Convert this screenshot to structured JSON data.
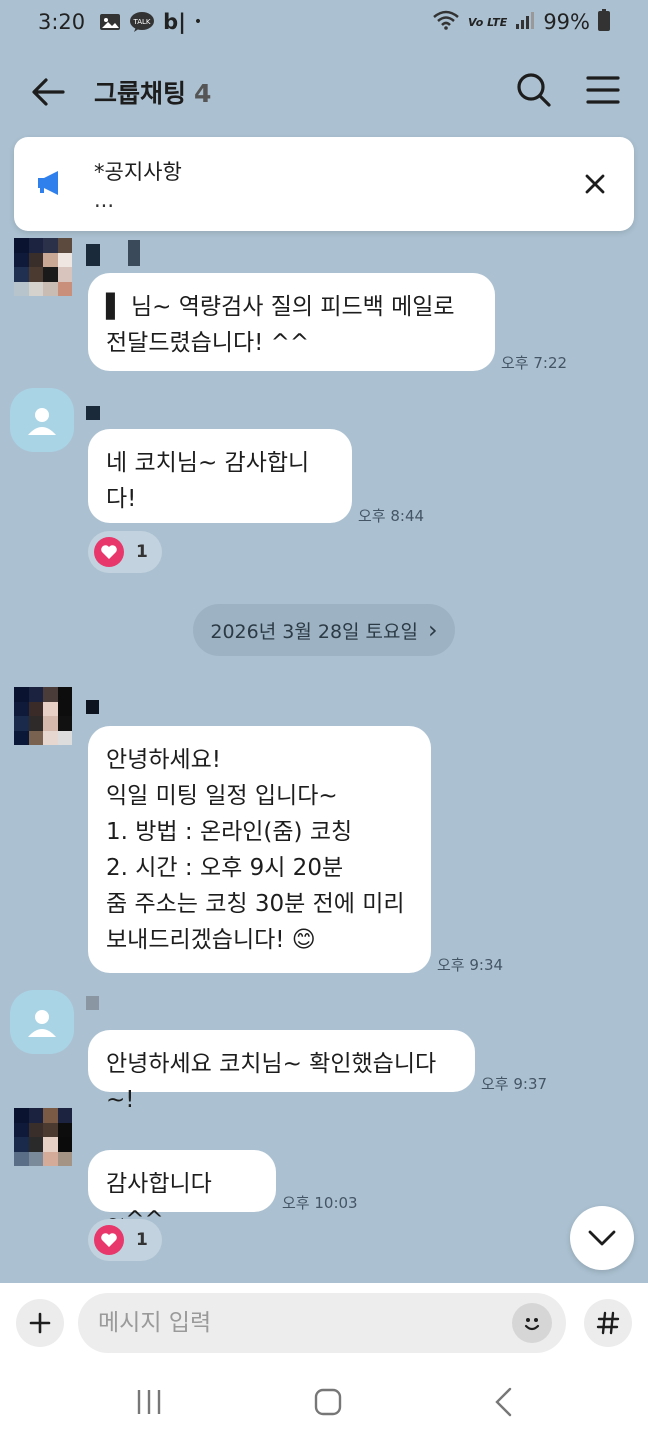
{
  "status": {
    "time": "3:20",
    "kakao_badge": "TALK",
    "app_text": "b|",
    "dot": "•",
    "network": "Vo LTE",
    "battery": "99%"
  },
  "header": {
    "title": "그룹채팅",
    "count": "4"
  },
  "notice": {
    "title": "*공지사항",
    "subtitle": "..."
  },
  "messages": [
    {
      "text": "▌ 님~ 역량검사 질의 피드백 메일로\n전달드렸습니다! ^^",
      "time": "오후 7:22"
    },
    {
      "text": "네 코치님~ 감사합니다!",
      "time": "오후 8:44",
      "reaction_count": "1"
    },
    {
      "text": "안녕하세요!\n익일 미팅 일정 입니다~\n1. 방법 : 온라인(줌) 코칭\n2. 시간 : 오후 9시 20분\n줌 주소는 코칭 30분 전에 미리\n보내드리겠습니다! 😊",
      "time": "오후 9:34"
    },
    {
      "text": "안녕하세요 코치님~ 확인했습니다~!",
      "time": "오후 9:37"
    },
    {
      "text": "감사합니다~^^",
      "time": "오후 10:03",
      "reaction_count": "1"
    }
  ],
  "date_divider": {
    "label": "2026년 3월 28일 토요일",
    "chevron": "›"
  },
  "input": {
    "placeholder": "메시지 입력"
  },
  "icons": {
    "back": "arrow-left",
    "search": "magnifier",
    "menu": "hamburger",
    "plus": "plus",
    "emoji": "smiley",
    "hash": "#",
    "scroll": "chevron-down"
  },
  "colors": {
    "background": "#abc1d1",
    "heart": "#e8376a",
    "megaphone": "#2f80ed"
  }
}
